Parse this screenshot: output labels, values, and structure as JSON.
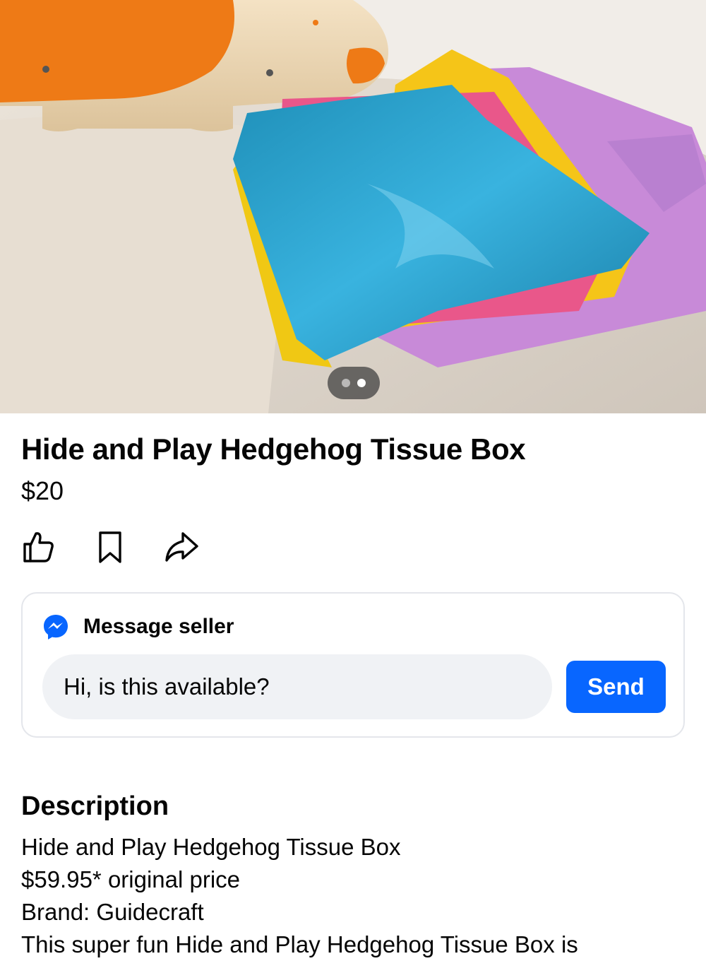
{
  "listing": {
    "title": "Hide and Play Hedgehog Tissue Box",
    "price": "$20",
    "image": {
      "description_icon": "product-photo",
      "current_page": 2,
      "total_pages": 2
    }
  },
  "actions": [
    {
      "icon": "like-icon"
    },
    {
      "icon": "save-icon"
    },
    {
      "icon": "share-icon"
    }
  ],
  "message": {
    "heading": "Message seller",
    "input_value": "Hi, is this available?",
    "send_label": "Send"
  },
  "description": {
    "heading": "Description",
    "lines": [
      "Hide and Play Hedgehog Tissue Box",
      "$59.95* original price",
      "Brand: Guidecraft",
      "This super fun Hide and Play Hedgehog Tissue Box is"
    ]
  },
  "colors": {
    "accent": "#0866ff",
    "input_bg": "#f0f2f5",
    "card_border": "#e4e6eb",
    "text": "#050505"
  }
}
